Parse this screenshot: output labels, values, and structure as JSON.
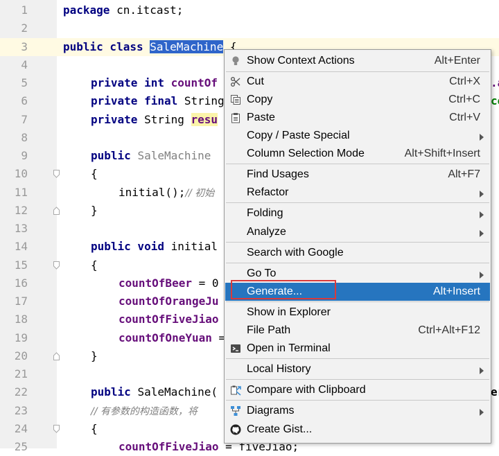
{
  "editor": {
    "lines": [
      {
        "n": "1"
      },
      {
        "n": "2"
      },
      {
        "n": "3"
      },
      {
        "n": "4"
      },
      {
        "n": "5"
      },
      {
        "n": "6"
      },
      {
        "n": "7"
      },
      {
        "n": "8"
      },
      {
        "n": "9"
      },
      {
        "n": "10"
      },
      {
        "n": "11"
      },
      {
        "n": "12"
      },
      {
        "n": "13"
      },
      {
        "n": "14"
      },
      {
        "n": "15"
      },
      {
        "n": "16"
      },
      {
        "n": "17"
      },
      {
        "n": "18"
      },
      {
        "n": "19"
      },
      {
        "n": "20"
      },
      {
        "n": "21"
      },
      {
        "n": "22"
      },
      {
        "n": "23"
      },
      {
        "n": "24"
      },
      {
        "n": "25"
      }
    ],
    "code": {
      "l1_kw": "package",
      "l1_rest": " cn.itcast;",
      "l3_kw": "public class ",
      "l3_sel": "SaleMachine",
      "l3_rest": " {",
      "l5_kw": "private int ",
      "l5_fld": "countOf",
      "l6_kw": "private final ",
      "l6_rest": "String",
      "l7_kw": "private ",
      "l7_rest": "String ",
      "l7_fld": "resu",
      "l9_kw": "public ",
      "l9_dim": "SaleMachine",
      "l10": "{",
      "l11_a": "initial();",
      "l11_cmt": "// 初始",
      "l12": "}",
      "l14_kw": "public void ",
      "l14_rest": "initial",
      "l15": "{",
      "l16_fld": "countOfBeer",
      "l16_rest": " = 0",
      "l17_fld": "countOfOrangeJu",
      "l18_fld": "countOfFiveJiao",
      "l19_fld": "countOfOneYuan",
      "l19_rest": " =",
      "l20": "}",
      "l22_kw": "public ",
      "l22_rest": "SaleMachine(",
      "l23_cmt": "// 有参数的构造函数，将",
      "l24": "{",
      "l25_fld": "countOfFiveJiao",
      "l25_rest": " = fiveJiao;",
      "peek_1": ".a",
      "peek_2": "ce",
      "peek_3": "er"
    }
  },
  "context_menu": {
    "show_context_actions": {
      "label": "Show Context Actions",
      "shortcut": "Alt+Enter"
    },
    "cut": {
      "label": "Cut",
      "shortcut": "Ctrl+X"
    },
    "copy": {
      "label": "Copy",
      "shortcut": "Ctrl+C"
    },
    "paste": {
      "label": "Paste",
      "shortcut": "Ctrl+V"
    },
    "copy_paste_special": {
      "label": "Copy / Paste Special"
    },
    "column_selection_mode": {
      "label": "Column Selection Mode",
      "shortcut": "Alt+Shift+Insert"
    },
    "find_usages": {
      "label": "Find Usages",
      "shortcut": "Alt+F7"
    },
    "refactor": {
      "label": "Refactor"
    },
    "folding": {
      "label": "Folding"
    },
    "analyze": {
      "label": "Analyze"
    },
    "search_with_google": {
      "label": "Search with Google"
    },
    "go_to": {
      "label": "Go To"
    },
    "generate": {
      "label": "Generate...",
      "shortcut": "Alt+Insert"
    },
    "show_in_explorer": {
      "label": "Show in Explorer"
    },
    "file_path": {
      "label": "File Path",
      "shortcut": "Ctrl+Alt+F12"
    },
    "open_in_terminal": {
      "label": "Open in Terminal"
    },
    "local_history": {
      "label": "Local History"
    },
    "compare_with_clipboard": {
      "label": "Compare with Clipboard"
    },
    "diagrams": {
      "label": "Diagrams"
    },
    "create_gist": {
      "label": "Create Gist..."
    }
  },
  "colors": {
    "selection": "#2f65ca",
    "menu_active": "#2675bf",
    "highlight_box": "#d93a3a"
  }
}
